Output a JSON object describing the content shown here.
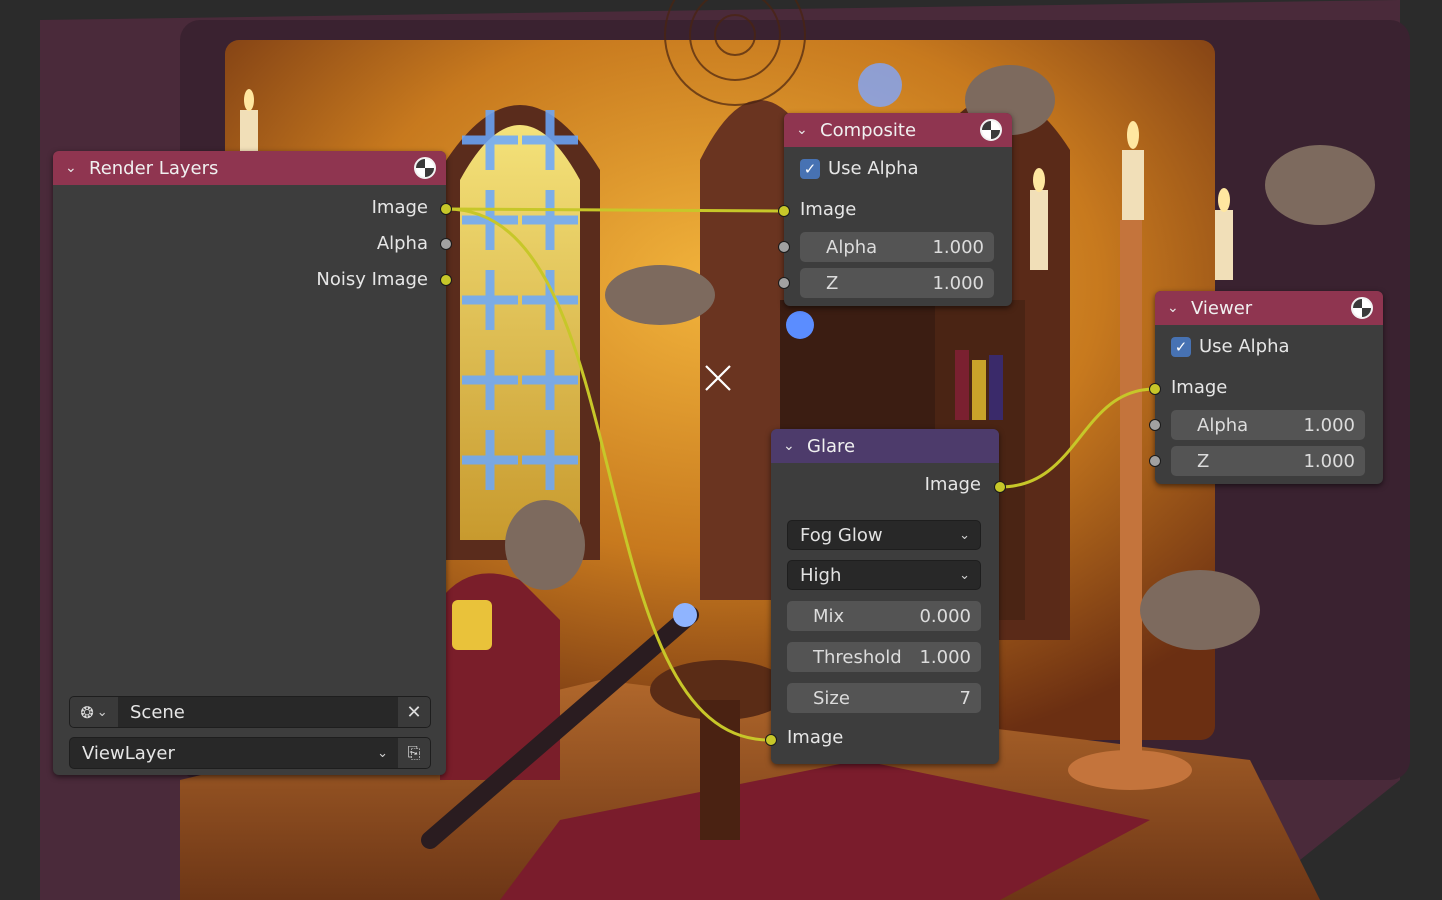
{
  "render_layers": {
    "title": "Render Layers",
    "outputs": [
      "Image",
      "Alpha",
      "Noisy Image"
    ],
    "scene_value": "Scene",
    "view_layer_value": "ViewLayer"
  },
  "composite": {
    "title": "Composite",
    "use_alpha_label": "Use Alpha",
    "use_alpha_checked": true,
    "inputs": {
      "image": "Image",
      "alpha": {
        "label": "Alpha",
        "value": "1.000"
      },
      "z": {
        "label": "Z",
        "value": "1.000"
      }
    }
  },
  "viewer": {
    "title": "Viewer",
    "use_alpha_label": "Use Alpha",
    "use_alpha_checked": true,
    "inputs": {
      "image": "Image",
      "alpha": {
        "label": "Alpha",
        "value": "1.000"
      },
      "z": {
        "label": "Z",
        "value": "1.000"
      }
    }
  },
  "glare": {
    "title": "Glare",
    "output": "Image",
    "glare_type": "Fog Glow",
    "quality": "High",
    "mix": {
      "label": "Mix",
      "value": "0.000"
    },
    "threshold": {
      "label": "Threshold",
      "value": "1.000"
    },
    "size": {
      "label": "Size",
      "value": "7"
    },
    "input": "Image"
  },
  "colors": {
    "output_header": "#8f3550",
    "filter_header": "#4d3b6b",
    "color_socket": "#c7c729",
    "float_socket": "#a1a1a1",
    "link": "#c7c729",
    "checkbox": "#4772b3"
  },
  "icons": [
    "chevron-down-icon",
    "preview-sphere-icon",
    "scene-icon",
    "close-icon",
    "new-layer-icon",
    "cursor-cross-icon"
  ]
}
